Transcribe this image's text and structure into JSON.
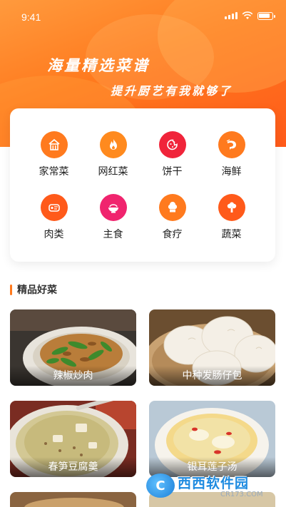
{
  "status_bar": {
    "time": "9:41"
  },
  "hero": {
    "slogan_main": "海量精选菜谱",
    "slogan_sub": "提升厨艺有我就够了"
  },
  "categories": [
    {
      "label": "家常菜",
      "icon": "home-icon",
      "color": "#ff7a1e"
    },
    {
      "label": "网红菜",
      "icon": "flame-icon",
      "color": "#ff8a1e"
    },
    {
      "label": "饼干",
      "icon": "cookie-icon",
      "color": "#f0243a"
    },
    {
      "label": "海鲜",
      "icon": "shrimp-icon",
      "color": "#ff7a1e"
    },
    {
      "label": "肉类",
      "icon": "meat-icon",
      "color": "#ff5a1a"
    },
    {
      "label": "主食",
      "icon": "rice-bowl-icon",
      "color": "#f0246e"
    },
    {
      "label": "食疗",
      "icon": "chef-hat-icon",
      "color": "#ff7a1e"
    },
    {
      "label": "蔬菜",
      "icon": "broccoli-icon",
      "color": "#ff5a1a"
    }
  ],
  "section": {
    "title": "精品好菜"
  },
  "dishes": [
    {
      "label": "辣椒炒肉"
    },
    {
      "label": "中种发肠仔包"
    },
    {
      "label": "春笋豆腐羹"
    },
    {
      "label": "银耳莲子汤"
    }
  ],
  "watermark": {
    "main": "西西软件园",
    "sub": "CR173.COM"
  }
}
